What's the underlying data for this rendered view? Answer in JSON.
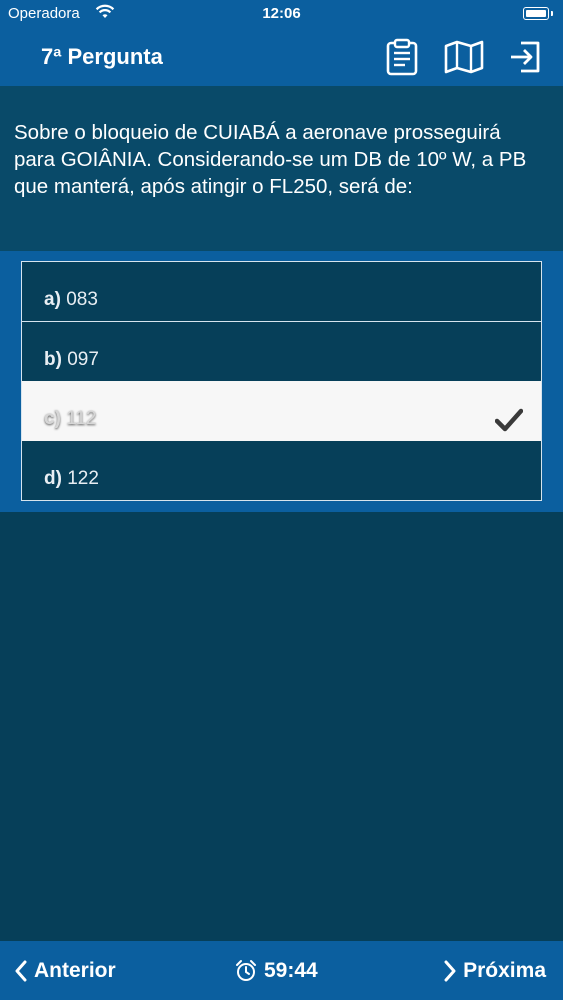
{
  "status_bar": {
    "carrier": "Operadora",
    "time": "12:06"
  },
  "nav": {
    "title": "7ª Pergunta",
    "icons": [
      "clipboard-icon",
      "map-icon",
      "exit-icon"
    ]
  },
  "question": {
    "text": "Sobre o bloqueio de CUIABÁ a aeronave prosseguirá para GOIÂNIA. Considerando-se um DB de 10º W, a PB que manterá, após atingir o FL250, será de:"
  },
  "options": [
    {
      "letter": "a)",
      "value": "083",
      "selected": false
    },
    {
      "letter": "b)",
      "value": "097",
      "selected": false
    },
    {
      "letter": "c)",
      "value": "112",
      "selected": true
    },
    {
      "letter": "d)",
      "value": "122",
      "selected": false
    }
  ],
  "footer": {
    "prev_label": "Anterior",
    "timer": "59:44",
    "next_label": "Próxima"
  },
  "colors": {
    "bar": "#0b5f9f",
    "background": "#063f59",
    "question_bg": "#094a69",
    "selected_option_bg": "#f7f7f7"
  }
}
